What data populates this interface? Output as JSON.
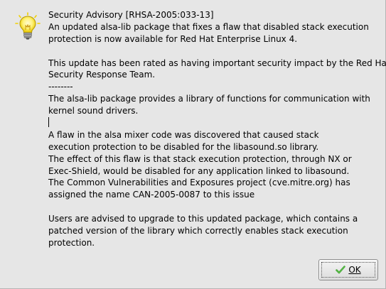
{
  "icon": "lightbulb-info-icon",
  "message": {
    "lines": [
      "Security Advisory [RHSA-2005:033-13]",
      "An updated alsa-lib package that fixes a flaw that disabled stack execution",
      "protection is now available for Red Hat Enterprise Linux 4.",
      "",
      "This update has been rated as having important security impact by the Red Hat",
      "Security Response Team.",
      "--------",
      "The alsa-lib package provides a library of functions for communication with",
      "kernel sound drivers.",
      "",
      "A flaw in the alsa mixer code was discovered that caused stack",
      "execution protection to be disabled for the libasound.so library.",
      "The effect of this flaw is that stack execution protection, through NX or",
      "Exec-Shield, would be disabled for any application linked to libasound.",
      "The Common Vulnerabilities and Exposures project (cve.mitre.org) has",
      "assigned the name CAN-2005-0087 to this issue",
      "",
      "Users are advised to upgrade to this updated package, which contains a",
      "patched version of the library which correctly enables stack execution",
      "protection."
    ]
  },
  "buttons": {
    "ok_label": "OK",
    "ok_icon": "checkmark-icon"
  },
  "colors": {
    "background": "#e6e6e6",
    "bulb_glow": "#fff27a",
    "bulb_body": "#f5d400",
    "check_green": "#2e9a1e"
  }
}
